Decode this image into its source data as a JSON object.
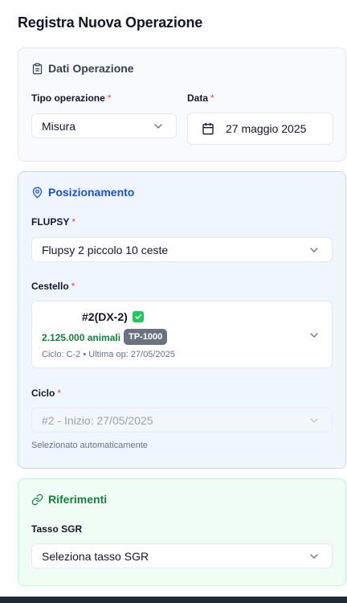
{
  "page": {
    "title": "Registra Nuova Operazione"
  },
  "dati": {
    "title": "Dati Operazione",
    "tipo_label": "Tipo operazione",
    "tipo_value": "Misura",
    "data_label": "Data",
    "data_value": "27 maggio 2025",
    "required_mark": "*"
  },
  "posizionamento": {
    "title": "Posizionamento",
    "flupsy_label": "FLUPSY",
    "flupsy_value": "Flupsy 2 piccolo 10 ceste",
    "cestello_label": "Cestello",
    "cestello": {
      "name": "#2(DX-2)",
      "animals": "2.125.000 animali",
      "badge": "TP-1000",
      "meta": "Ciclo: C-2 • Ultima op: 27/05/2025"
    },
    "ciclo_label": "Ciclo",
    "ciclo_value": "#2 - Inizio: 27/05/2025",
    "ciclo_hint": "Selezionato automaticamente"
  },
  "riferimenti": {
    "title": "Riferimenti",
    "sgr_label": "Tasso SGR",
    "sgr_placeholder": "Seleziona tasso SGR"
  },
  "icons": {
    "dati": "clipboard-icon",
    "posizionamento": "map-pin-icon",
    "riferimenti": "link-icon",
    "date": "calendar-icon",
    "check": "check-badge-icon",
    "dropdown": "chevron-down-icon"
  },
  "colors": {
    "required": "#ef4444",
    "posizionamento_accent": "#1d4ed8",
    "riferimenti_accent": "#15803d",
    "animals_text": "#15803d",
    "check_badge": "#22c55e"
  }
}
